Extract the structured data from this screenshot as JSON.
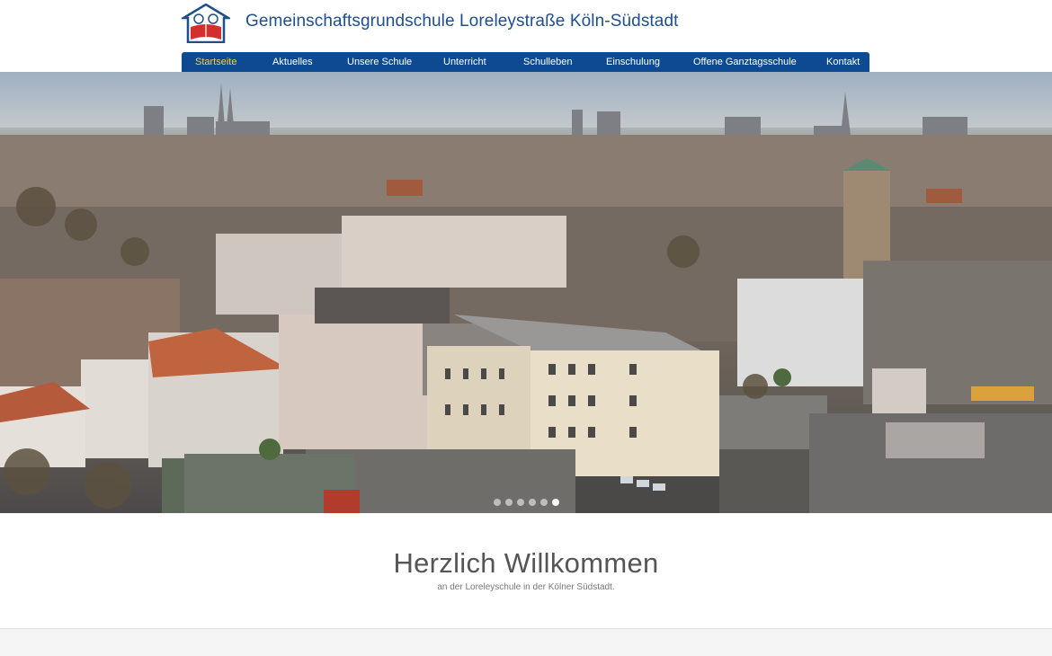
{
  "header": {
    "site_title": "Gemeinschaftsgrundschule Loreleystraße Köln-Südstadt",
    "logo_icon": "school-book-children-logo"
  },
  "nav": {
    "items": [
      {
        "label": "Startseite",
        "active": true
      },
      {
        "label": "Aktuelles"
      },
      {
        "label": "Unsere Schule"
      },
      {
        "label": "Unterricht"
      },
      {
        "label": "Schulleben"
      },
      {
        "label": "Einschulung"
      },
      {
        "label": "Offene Ganztagsschule"
      },
      {
        "label": "Kontakt"
      }
    ],
    "colors": {
      "background": "#0d4a91",
      "text": "#ffffff",
      "active": "#f3d34a"
    }
  },
  "hero": {
    "slides_count": 6,
    "active_slide": 6
  },
  "welcome": {
    "heading": "Herzlich Willkommen",
    "subtext": "an der Loreleyschule in der Kölner Südstadt."
  }
}
